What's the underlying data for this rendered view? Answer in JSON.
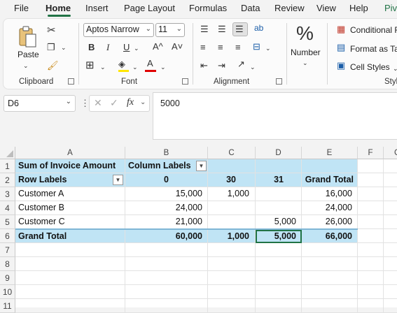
{
  "menu": {
    "tabs": [
      "File",
      "Home",
      "Insert",
      "Page Layout",
      "Formulas",
      "Data",
      "Review",
      "View",
      "Help",
      "Pive"
    ],
    "active": "Home",
    "accent": "#217346"
  },
  "ribbon": {
    "clipboard": {
      "label": "Clipboard",
      "paste_label": "Paste"
    },
    "font": {
      "label": "Font",
      "font_name": "Aptos Narrow",
      "font_size": "11",
      "bold": "B",
      "italic": "I",
      "underline": "U",
      "grow": "A^",
      "shrink": "A˅",
      "font_color_glyph": "A"
    },
    "alignment": {
      "label": "Alignment"
    },
    "number": {
      "label": "Number",
      "button_label": "Number",
      "percent_glyph": "%"
    },
    "styles": {
      "label": "Style",
      "conditional": "Conditional F",
      "format_table": "Format as Ta",
      "cell_styles": "Cell Styles"
    },
    "font_color_swatch": "#e00000",
    "highlight_swatch": "#ffe600"
  },
  "formula_bar": {
    "name_box": "D6",
    "fx_label": "fx",
    "value": "5000"
  },
  "grid": {
    "columns": [
      "A",
      "B",
      "C",
      "D",
      "E",
      "F",
      "G"
    ],
    "rows": [
      "1",
      "2",
      "3",
      "4",
      "5",
      "6",
      "7",
      "8",
      "9",
      "10",
      "11"
    ],
    "highlight_color": "#c0e4f5",
    "pivot": {
      "r1": {
        "a": "Sum of Invoice Amount",
        "b": "Column Labels"
      },
      "r2": {
        "a": "Row Labels",
        "b": "0",
        "c": "30",
        "d": "31",
        "e": "Grand Total"
      },
      "r3": {
        "a": "Customer A",
        "b": "15,000",
        "c": "1,000",
        "d": "",
        "e": "16,000"
      },
      "r4": {
        "a": "Customer B",
        "b": "24,000",
        "c": "",
        "d": "",
        "e": "24,000"
      },
      "r5": {
        "a": "Customer C",
        "b": "21,000",
        "c": "",
        "d": "5,000",
        "e": "26,000"
      },
      "r6": {
        "a": "Grand Total",
        "b": "60,000",
        "c": "1,000",
        "d": "5,000",
        "e": "66,000"
      }
    }
  }
}
